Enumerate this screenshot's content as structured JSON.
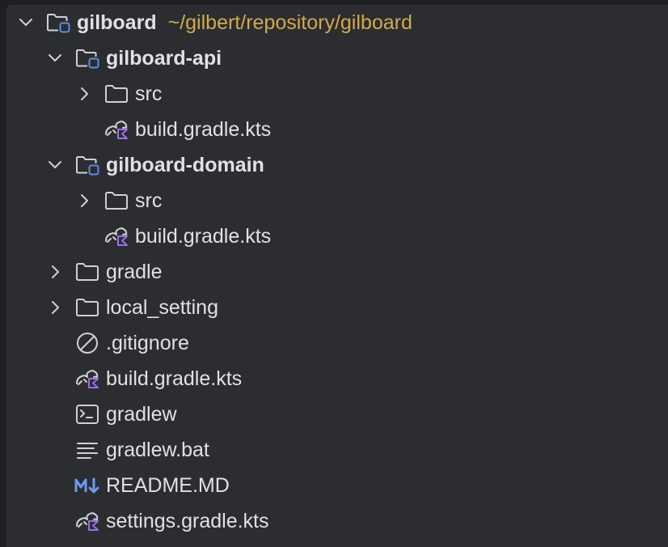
{
  "tree": {
    "root": {
      "label": "gilboard",
      "path": "~/gilbert/repository/gilboard"
    },
    "items": [
      {
        "label": "gilboard-api"
      },
      {
        "label": "src"
      },
      {
        "label": "build.gradle.kts"
      },
      {
        "label": "gilboard-domain"
      },
      {
        "label": "src"
      },
      {
        "label": "build.gradle.kts"
      },
      {
        "label": "gradle"
      },
      {
        "label": "local_setting"
      },
      {
        "label": ".gitignore"
      },
      {
        "label": "build.gradle.kts"
      },
      {
        "label": "gradlew"
      },
      {
        "label": "gradlew.bat"
      },
      {
        "label": "README.MD"
      },
      {
        "label": "settings.gradle.kts"
      }
    ],
    "colors": {
      "background": "#2b2d30",
      "text": "#dfe1e5",
      "path": "#d4a94c",
      "module_badge": "#5c8de6",
      "kotlin_badge": "#9c6ee8",
      "markdown_icon": "#6b9bf0"
    }
  }
}
